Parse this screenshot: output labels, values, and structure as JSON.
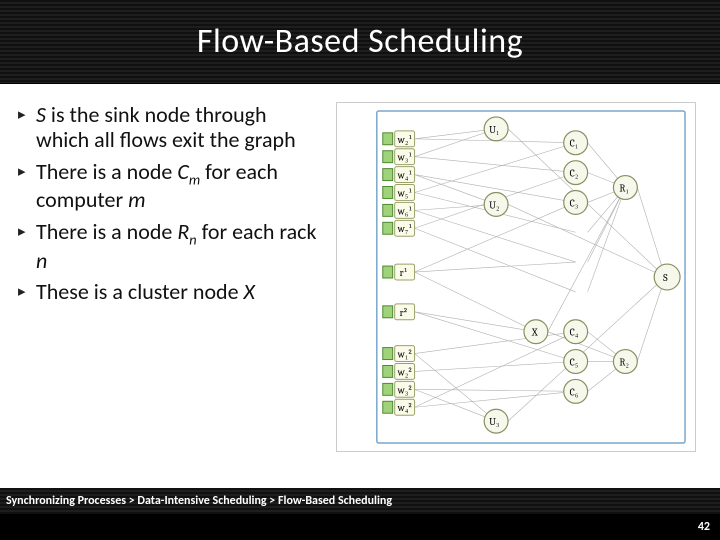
{
  "title": "Flow-Based Scheduling",
  "bullets": [
    {
      "html": "<em>S</em> is the sink node through which all flows exit the graph"
    },
    {
      "html": "There is a node <em>C</em><sub>m</sub> for each computer <em>m</em>"
    },
    {
      "html": "There is a node <em>R</em><sub>n</sub> for each rack <em>n</em>"
    },
    {
      "html": "These is a cluster node <em>X</em>"
    }
  ],
  "breadcrumb": "Synchronizing Processes > Data-Intensive Scheduling > Flow-Based Scheduling",
  "page_number": "42",
  "triangle": "▸",
  "diagram": {
    "workers_r1": [
      "w₂¹",
      "w₃¹",
      "w₄¹",
      "w₅¹",
      "w₆¹",
      "w₇¹"
    ],
    "workers_r2": [
      "w₁²",
      "w₂²",
      "w₃²",
      "w₄²"
    ],
    "r_nodes": [
      "r¹",
      "r²"
    ],
    "u_nodes": [
      "U₁",
      "U₂",
      "U₃"
    ],
    "c_nodes": [
      "C₁",
      "C₂",
      "C₃",
      "C₄",
      "C₅",
      "C₆"
    ],
    "r_big": [
      "R₁",
      "R₂"
    ],
    "x_node": "X",
    "s_node": "S"
  }
}
